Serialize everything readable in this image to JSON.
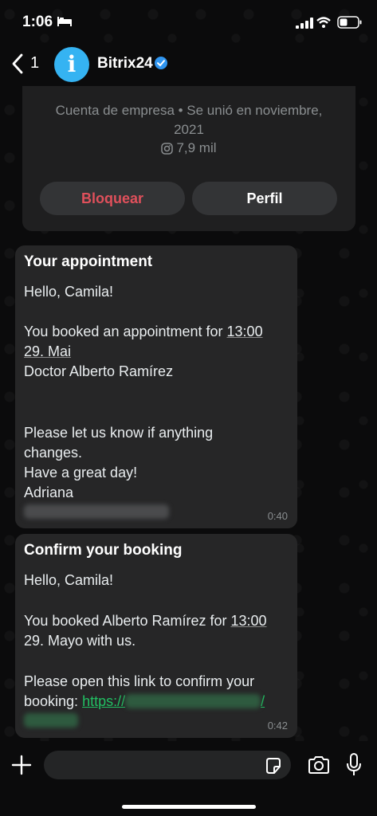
{
  "status_bar": {
    "time": "1:06"
  },
  "header": {
    "back_count": "1",
    "avatar_letter": "i",
    "contact_name": "Bitrix24"
  },
  "business_card": {
    "account_line1": "Cuenta de empresa • Se unió en noviembre,",
    "account_line2": "2021",
    "followers": "7,9 mil",
    "block_label": "Bloquear",
    "profile_label": "Perfil"
  },
  "messages": [
    {
      "title": "Your appointment",
      "greeting": "Hello, Camila!",
      "line1_prefix": "You booked an appointment for ",
      "line1_time": "13:00",
      "line2_date": "29. Mai",
      "line3": "Doctor Alberto Ramírez",
      "line4": "Please let us know if anything",
      "line5": "changes.",
      "line6": "Have a great day!",
      "line7": "Adriana",
      "time": "0:40"
    },
    {
      "title": "Confirm your booking",
      "greeting": "Hello, Camila!",
      "line1_prefix": "You booked Alberto Ramírez for ",
      "line1_time": "13:00",
      "line2_date": "29. Mayo",
      "line2_suffix": " with us.",
      "line3": "Please open this link to confirm your",
      "line4_prefix": "booking: ",
      "link_start": "https://",
      "link_end": "/",
      "time": "0:42"
    }
  ],
  "colors": {
    "accent_green": "#21c063",
    "block_red": "#e0505b",
    "avatar_blue": "#35b3f2"
  },
  "icons": [
    "bed-icon",
    "signal-icon",
    "wifi-icon",
    "battery-icon",
    "back-chevron-icon",
    "verified-badge-icon",
    "instagram-icon",
    "plus-icon",
    "sticker-icon",
    "camera-icon",
    "mic-icon"
  ]
}
